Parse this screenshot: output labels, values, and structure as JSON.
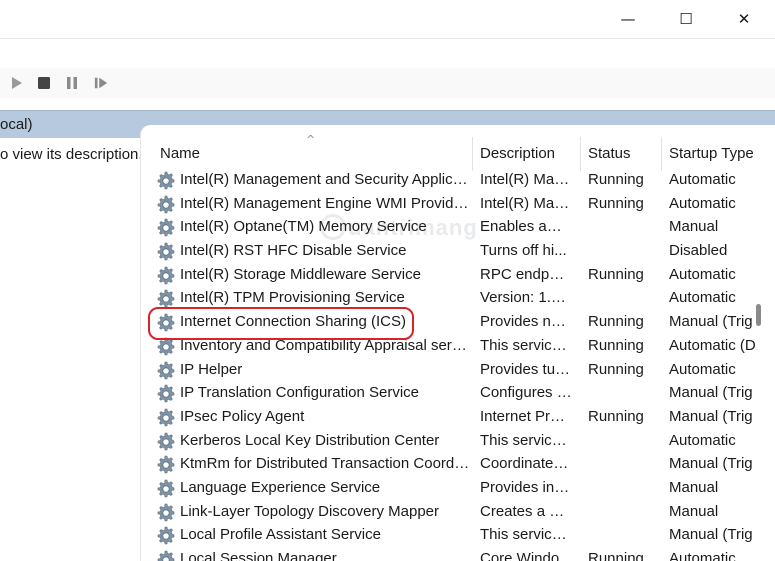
{
  "window": {
    "minimize_glyph": "—",
    "maximize_glyph": "☐",
    "close_glyph": "✕"
  },
  "toolbar": {
    "icons": [
      "play-icon",
      "stop-icon",
      "pause-icon",
      "restart-icon"
    ]
  },
  "panel": {
    "header": "ocal)",
    "description_hint": "o view its description."
  },
  "columns": {
    "name": "Name",
    "description": "Description",
    "status": "Status",
    "startup_type": "Startup Type"
  },
  "sort_indicator": "^",
  "services": [
    {
      "name": "Intel(R) Management and Security Applicati...",
      "description": "Intel(R) Man...",
      "status": "Running",
      "startup": "Automatic"
    },
    {
      "name": "Intel(R) Management Engine WMI Provider...",
      "description": "Intel(R) Man...",
      "status": "Running",
      "startup": "Automatic"
    },
    {
      "name": "Intel(R) Optane(TM) Memory Service",
      "description": "Enables ama...",
      "status": "",
      "startup": "Manual"
    },
    {
      "name": "Intel(R) RST HFC Disable Service",
      "description": "Turns off hi...",
      "status": "",
      "startup": "Disabled"
    },
    {
      "name": "Intel(R) Storage Middleware Service",
      "description": "RPC endpoi...",
      "status": "Running",
      "startup": "Automatic"
    },
    {
      "name": "Intel(R) TPM Provisioning Service",
      "description": "Version: 1.52...",
      "status": "",
      "startup": "Automatic"
    },
    {
      "name": "Internet Connection Sharing (ICS)",
      "description": "Provides net...",
      "status": "Running",
      "startup": "Manual (Trig"
    },
    {
      "name": "Inventory and Compatibility Appraisal servi...",
      "description": "This service ...",
      "status": "Running",
      "startup": "Automatic (D"
    },
    {
      "name": "IP Helper",
      "description": "Provides tun...",
      "status": "Running",
      "startup": "Automatic"
    },
    {
      "name": "IP Translation Configuration Service",
      "description": "Configures a...",
      "status": "",
      "startup": "Manual (Trig"
    },
    {
      "name": "IPsec Policy Agent",
      "description": "Internet Prot...",
      "status": "Running",
      "startup": "Manual (Trig"
    },
    {
      "name": "Kerberos Local Key Distribution Center",
      "description": "This service ...",
      "status": "",
      "startup": "Automatic"
    },
    {
      "name": "KtmRm for Distributed Transaction Coordin...",
      "description": "Coordinates ...",
      "status": "",
      "startup": "Manual (Trig"
    },
    {
      "name": "Language Experience Service",
      "description": "Provides infr...",
      "status": "",
      "startup": "Manual"
    },
    {
      "name": "Link-Layer Topology Discovery Mapper",
      "description": "Creates a Ne...",
      "status": "",
      "startup": "Manual"
    },
    {
      "name": "Local Profile Assistant Service",
      "description": "This service ...",
      "status": "",
      "startup": "Manual (Trig"
    },
    {
      "name": "Local Session Manager",
      "description": "Core Windo...",
      "status": "Running",
      "startup": "Automatic"
    }
  ],
  "watermark": "uantrimang",
  "highlight_color": "#d9232a",
  "header_bg": "#b7c9de"
}
